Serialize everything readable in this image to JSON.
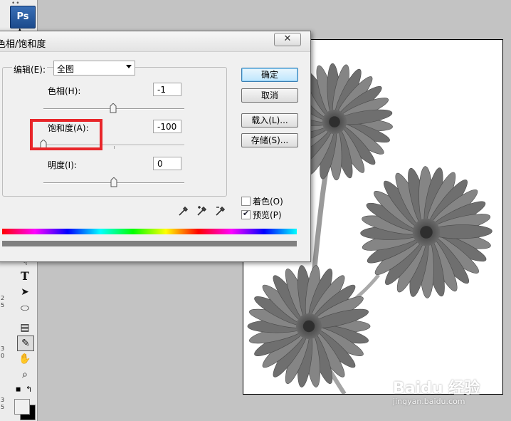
{
  "app": {
    "logo": "Ps"
  },
  "toolbar": {
    "tools": [
      {
        "icon": "hand-glyph-icon",
        "glyph": "☟"
      },
      {
        "icon": "type-tool-icon",
        "glyph": "T"
      },
      {
        "icon": "path-selection-icon",
        "glyph": "➤"
      },
      {
        "icon": "ellipse-tool-icon",
        "glyph": "⬭"
      },
      {
        "icon": "notes-tool-icon",
        "glyph": "▤"
      },
      {
        "icon": "eyedropper-tool-icon",
        "glyph": "✎"
      },
      {
        "icon": "hand-tool-icon",
        "glyph": "✋"
      },
      {
        "icon": "zoom-tool-icon",
        "glyph": "⌕"
      }
    ],
    "ruler_marks": [
      "2",
      "5",
      "3",
      "0",
      "3",
      "5"
    ]
  },
  "dialog": {
    "title": "色相/饱和度",
    "close_glyph": "✕",
    "edit_label": "编辑(E):",
    "edit_value": "全图",
    "hue": {
      "label": "色相(H):",
      "value": "-1",
      "level": -1,
      "min": -180,
      "max": 180
    },
    "saturation": {
      "label": "饱和度(A):",
      "value": "-100",
      "level": -100,
      "min": -100,
      "max": 100
    },
    "lightness": {
      "label": "明度(I):",
      "value": "0",
      "level": 0,
      "min": -100,
      "max": 100
    },
    "buttons": {
      "ok": "确定",
      "cancel": "取消",
      "load": "载入(L)...",
      "save": "存储(S)..."
    },
    "colorize": {
      "label": "着色(O)",
      "checked": false
    },
    "preview": {
      "label": "预览(P)",
      "checked": true
    }
  },
  "watermark": {
    "main": "Baidu 经验",
    "url": "jingyan.baidu.com"
  },
  "colors": {
    "highlight": "#e8262a",
    "default_button": "#bee6fd"
  }
}
